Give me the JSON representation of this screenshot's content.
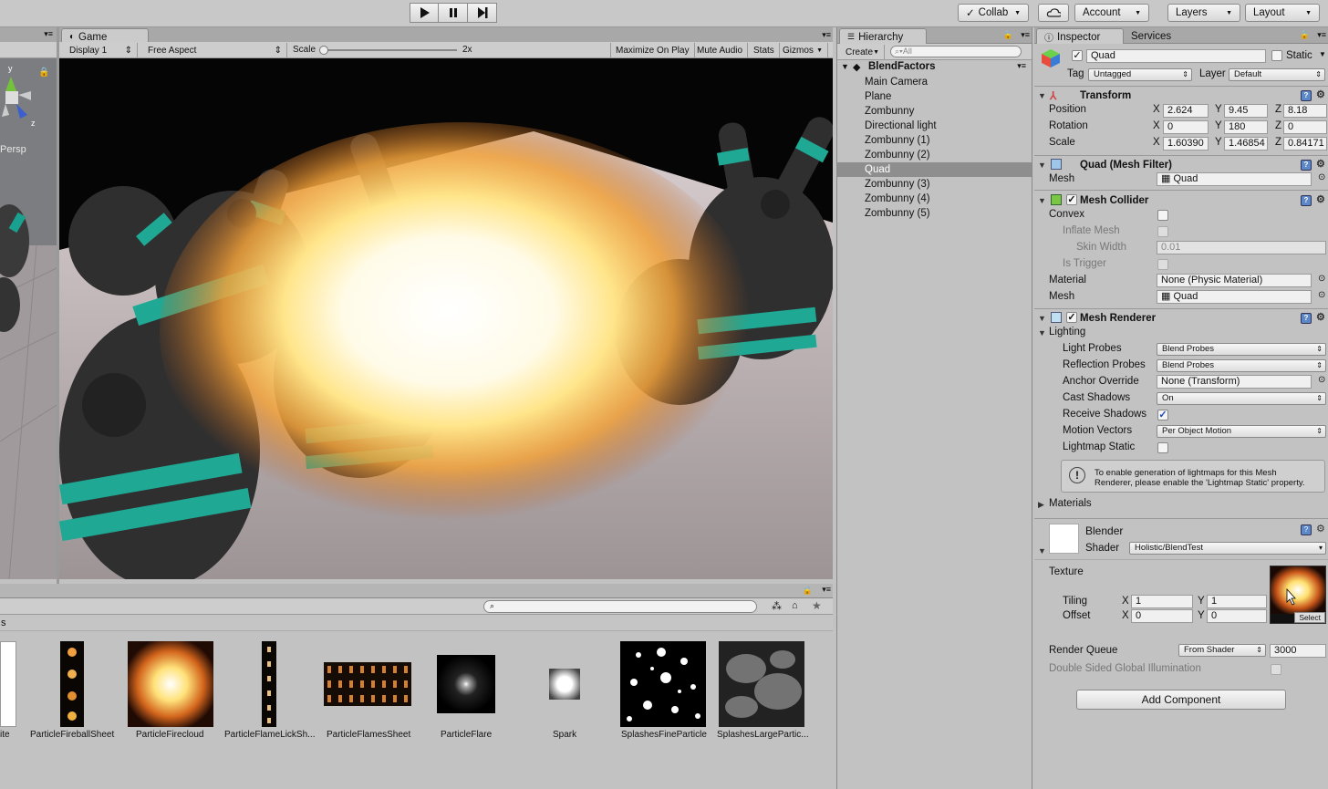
{
  "toolbar": {
    "collab": "Collab",
    "account": "Account",
    "layers": "Layers",
    "layout": "Layout"
  },
  "game_panel": {
    "tab": "Game",
    "display": "Display 1",
    "aspect": "Free Aspect",
    "scale_label": "Scale",
    "scale_value": "2x",
    "maximize": "Maximize On Play",
    "mute": "Mute Audio",
    "stats": "Stats",
    "gizmos": "Gizmos"
  },
  "scene_panel": {
    "persp": "Persp",
    "axis_y": "y",
    "axis_z": "z"
  },
  "hierarchy": {
    "tab": "Hierarchy",
    "create": "Create",
    "search_placeholder": "All",
    "scene_name": "BlendFactors",
    "items": [
      {
        "label": "Main Camera"
      },
      {
        "label": "Plane"
      },
      {
        "label": "Zombunny"
      },
      {
        "label": "Directional light"
      },
      {
        "label": "Zombunny (1)"
      },
      {
        "label": "Zombunny (2)"
      },
      {
        "label": "Quad"
      },
      {
        "label": "Zombunny (3)"
      },
      {
        "label": "Zombunny (4)"
      },
      {
        "label": "Zombunny (5)"
      }
    ],
    "selected_index": 6
  },
  "inspector": {
    "tab": "Inspector",
    "services_tab": "Services",
    "object_name": "Quad",
    "static_label": "Static",
    "tag_label": "Tag",
    "tag_value": "Untagged",
    "layer_label": "Layer",
    "layer_value": "Default",
    "transform": {
      "title": "Transform",
      "position_label": "Position",
      "rotation_label": "Rotation",
      "scale_label": "Scale",
      "position": [
        "2.624",
        "9.45",
        "8.18"
      ],
      "rotation": [
        "0",
        "180",
        "0"
      ],
      "scale": [
        "1.60390",
        "1.46854",
        "0.84171"
      ]
    },
    "axis": {
      "x": "X",
      "y": "Y",
      "z": "Z"
    },
    "mesh_filter": {
      "title": "Quad (Mesh Filter)",
      "mesh_label": "Mesh",
      "mesh_value": "Quad"
    },
    "mesh_collider": {
      "title": "Mesh Collider",
      "convex": "Convex",
      "inflate": "Inflate Mesh",
      "skin_width": "Skin Width",
      "skin_value": "0.01",
      "is_trigger": "Is Trigger",
      "material_label": "Material",
      "material_value": "None (Physic Material)",
      "mesh_label": "Mesh",
      "mesh_value": "Quad"
    },
    "mesh_renderer": {
      "title": "Mesh Renderer",
      "lighting": "Lighting",
      "light_probes": "Light Probes",
      "light_probes_value": "Blend Probes",
      "reflection_probes": "Reflection Probes",
      "reflection_probes_value": "Blend Probes",
      "anchor_override": "Anchor Override",
      "anchor_value": "None (Transform)",
      "cast_shadows": "Cast Shadows",
      "cast_shadows_value": "On",
      "receive_shadows": "Receive Shadows",
      "motion_vectors": "Motion Vectors",
      "motion_vectors_value": "Per Object Motion",
      "lightmap_static": "Lightmap Static",
      "help_line1": "To enable generation of lightmaps for this Mesh",
      "help_line2": "Renderer, please enable the 'Lightmap Static' property.",
      "materials": "Materials"
    },
    "material": {
      "name": "Blender",
      "shader_label": "Shader",
      "shader_value": "Holistic/BlendTest",
      "texture_label": "Texture",
      "tiling_label": "Tiling",
      "offset_label": "Offset",
      "tiling": [
        "1",
        "1"
      ],
      "offset": [
        "0",
        "0"
      ],
      "select": "Select",
      "render_queue_label": "Render Queue",
      "render_queue_mode": "From Shader",
      "render_queue_value": "3000",
      "double_sided": "Double Sided Global Illumination"
    },
    "add_component": "Add Component"
  },
  "project": {
    "partial_header": "s",
    "assets": [
      {
        "label": "ite"
      },
      {
        "label": "ParticleFireballSheet"
      },
      {
        "label": "ParticleFirecloud"
      },
      {
        "label": "ParticleFlameLickSh..."
      },
      {
        "label": "ParticleFlamesSheet"
      },
      {
        "label": "ParticleFlare"
      },
      {
        "label": "Spark"
      },
      {
        "label": "SplashesFineParticle"
      },
      {
        "label": "SplashesLargePartic..."
      }
    ]
  },
  "colors": {
    "selection": "#8e8e8e",
    "help_blue": "#5a88c8",
    "panel_bg": "#c2c2c2"
  }
}
